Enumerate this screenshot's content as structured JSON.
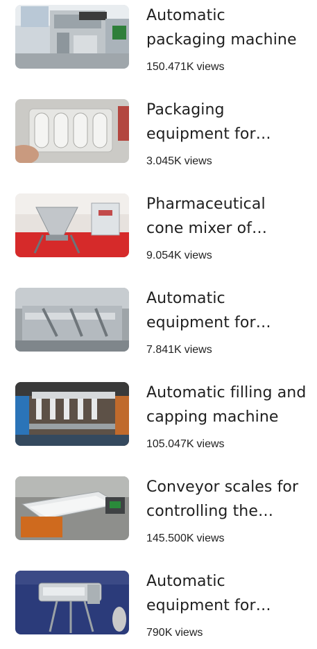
{
  "videos": [
    {
      "title": "Automatic packaging machine",
      "views": "150.471K",
      "views_unit": "views",
      "thumb_scene": "packaging-machine-in-exhibition-hall"
    },
    {
      "title": "Packaging equipment for blisters",
      "views": "3.045K",
      "views_unit": "views",
      "thumb_scene": "hand-holding-white-capsule-blister"
    },
    {
      "title": "Pharmaceutical cone mixer of powders",
      "views": "9.054K",
      "views_unit": "views",
      "thumb_scene": "steel-cone-mixer-on-red-stand"
    },
    {
      "title": "Automatic equipment for packing",
      "views": "7.841K",
      "views_unit": "views",
      "thumb_scene": "stainless-conveyor-with-arms"
    },
    {
      "title": "Automatic filling and capping machine",
      "views": "105.047K",
      "views_unit": "views",
      "thumb_scene": "filling-nozzles-over-bottles"
    },
    {
      "title": "Conveyor scales for controlling the weight",
      "views": "145.500K",
      "views_unit": "views",
      "thumb_scene": "checkweigher-conveyor-on-orange-frame"
    },
    {
      "title": "Automatic equipment for labeling",
      "views": "790K",
      "views_unit": "views",
      "thumb_scene": "steel-labeler-on-blue-carpet"
    }
  ],
  "colors": {
    "title": "#1f1f1f",
    "meta": "#222222",
    "background": "#ffffff"
  }
}
